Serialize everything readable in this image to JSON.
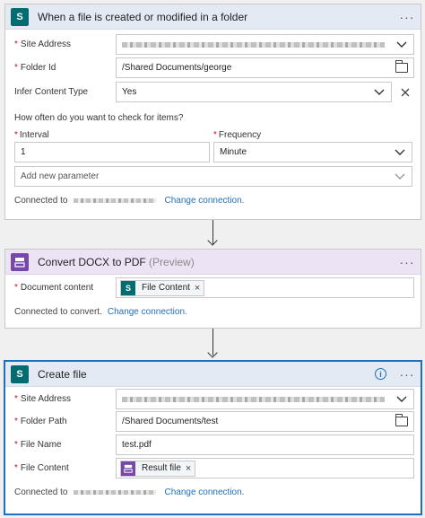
{
  "trigger": {
    "title": "When a file is created or modified in a folder",
    "site_address_label": "Site Address",
    "folder_id_label": "Folder Id",
    "folder_id_value": "/Shared Documents/george",
    "infer_label": "Infer Content Type",
    "infer_value": "Yes",
    "question": "How often do you want to check for items?",
    "interval_label": "Interval",
    "interval_value": "1",
    "frequency_label": "Frequency",
    "frequency_value": "Minute",
    "add_param_placeholder": "Add new parameter",
    "connected_prefix": "Connected to",
    "change_connection": "Change connection."
  },
  "convert": {
    "title": "Convert DOCX to PDF",
    "title_tag": "(Preview)",
    "doc_content_label": "Document content",
    "token_label": "File Content",
    "connected_text": "Connected to convert.",
    "change_connection": "Change connection."
  },
  "create": {
    "title": "Create file",
    "site_address_label": "Site Address",
    "folder_path_label": "Folder Path",
    "folder_path_value": "/Shared Documents/test",
    "file_name_label": "File Name",
    "file_name_value": "test.pdf",
    "file_content_label": "File Content",
    "token_label": "Result file",
    "connected_prefix": "Connected to",
    "change_connection": "Change connection."
  },
  "icons": {
    "sharepoint": "sharepoint-icon",
    "converter": "converter-icon",
    "more": "more-options-icon",
    "info": "info-icon"
  },
  "colors": {
    "sharepoint": "#036c70",
    "converter": "#7648a8",
    "link": "#1f6fbe",
    "required": "#c8102e"
  }
}
